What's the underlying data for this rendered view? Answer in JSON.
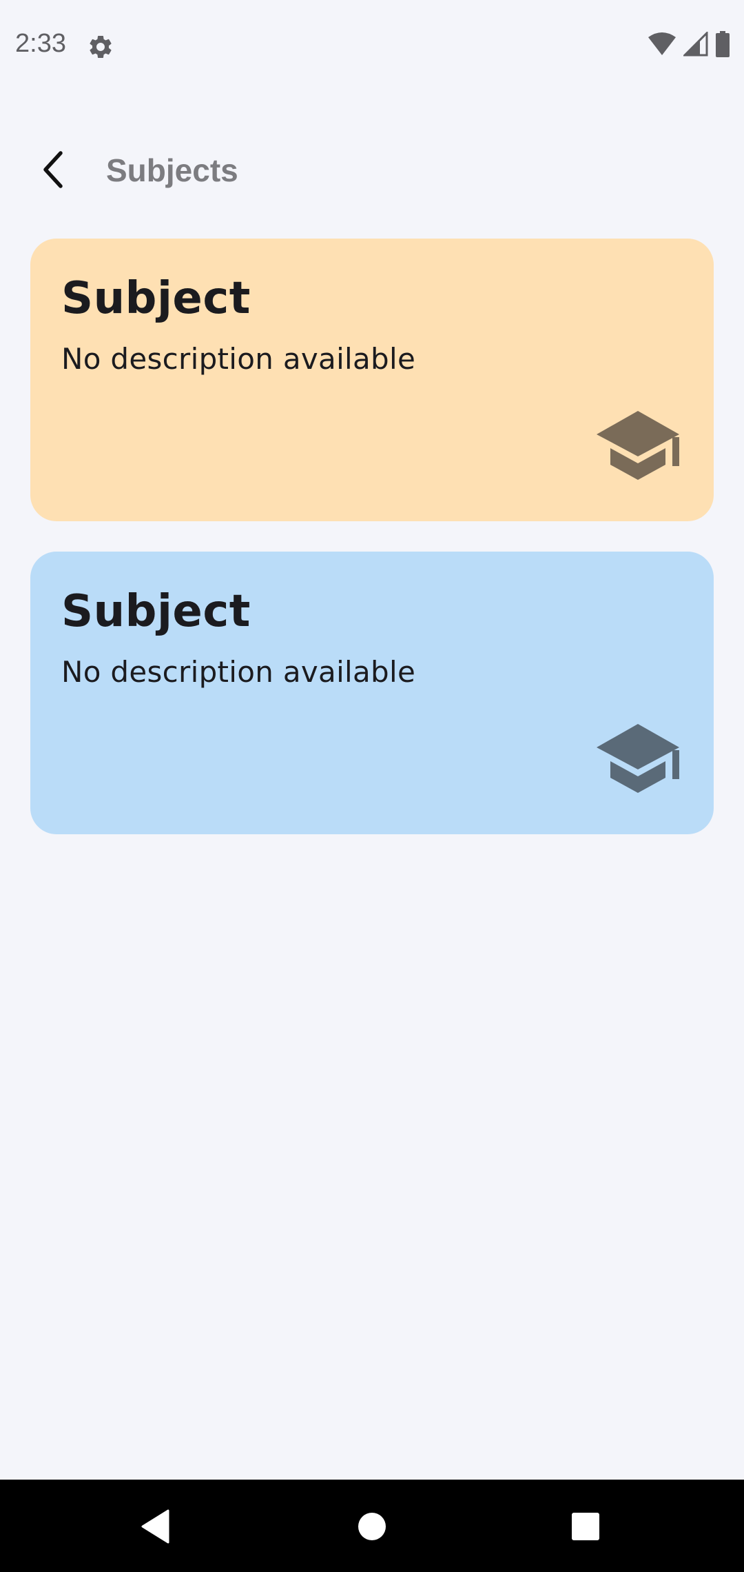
{
  "status_bar": {
    "time": "2:33",
    "icons": [
      "settings-icon",
      "wifi-icon",
      "signal-icon",
      "battery-icon"
    ]
  },
  "app_bar": {
    "back_icon": "arrow-back-icon",
    "title": "Subjects"
  },
  "subjects": [
    {
      "title": "Subject",
      "description": "No description available",
      "icon": "graduation-cap-icon",
      "background": "#fee0b3",
      "icon_color": "#7a6b58"
    },
    {
      "title": "Subject",
      "description": "No description available",
      "icon": "graduation-cap-icon",
      "background": "#badcf8",
      "icon_color": "#5a6a78"
    }
  ],
  "nav_bar": {
    "buttons": [
      "nav-back-icon",
      "nav-home-icon",
      "nav-recents-icon"
    ]
  }
}
